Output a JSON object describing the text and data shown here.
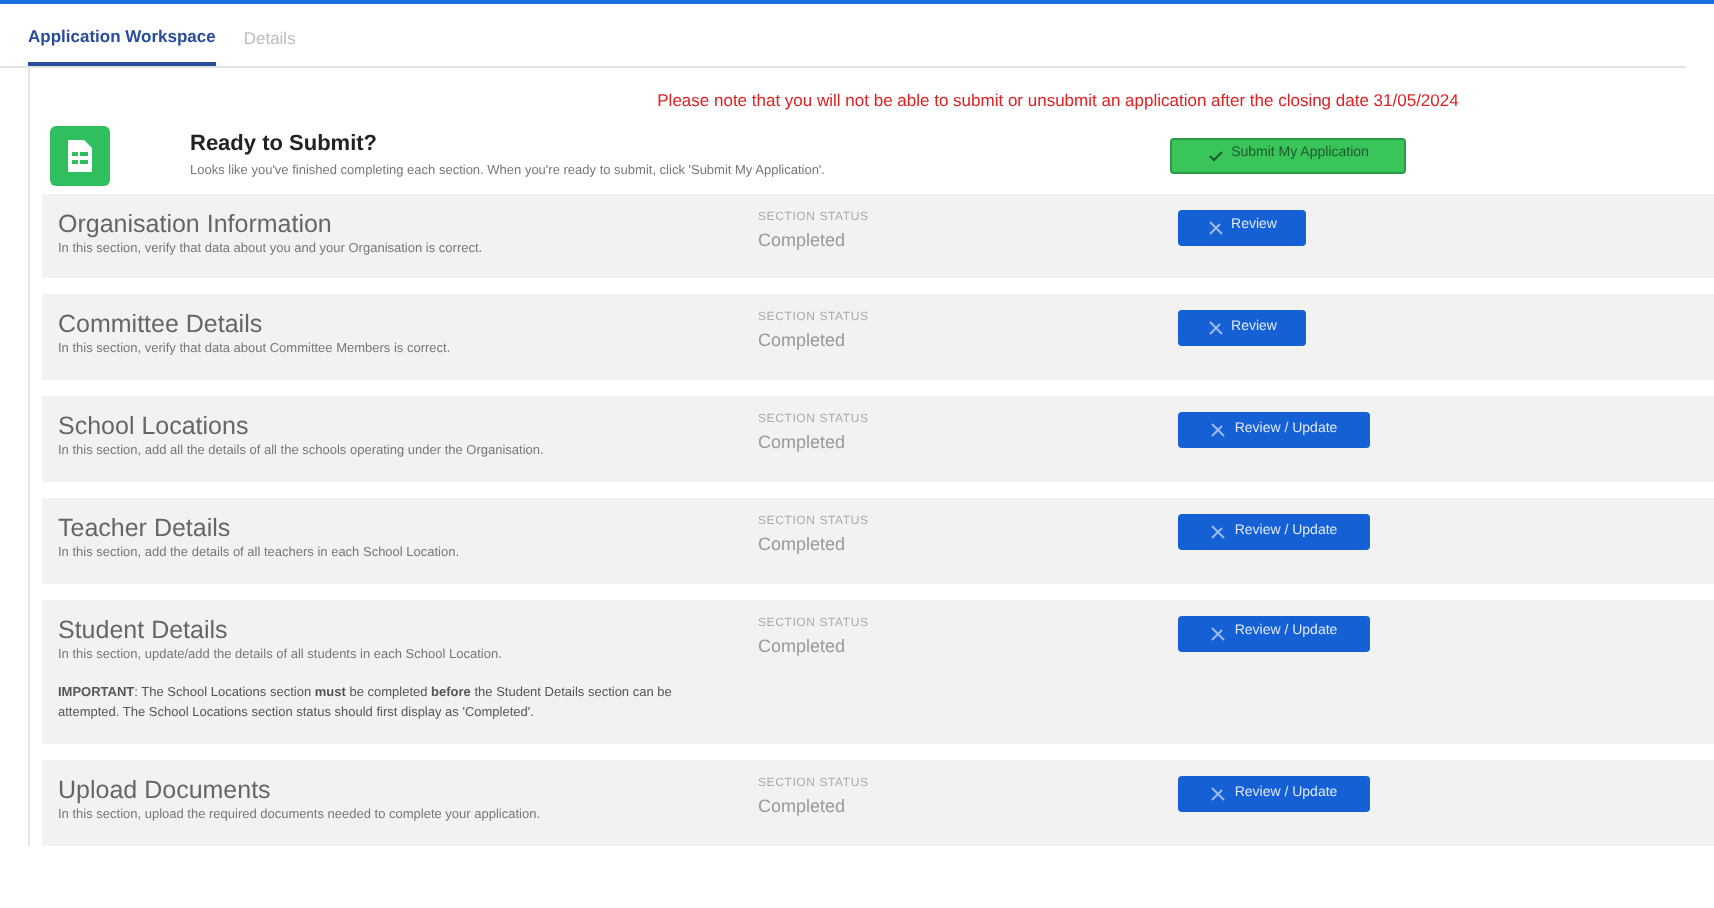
{
  "tabs": [
    {
      "label": "Application Workspace",
      "selected": true
    },
    {
      "label": "Details",
      "selected": false
    }
  ],
  "notice": "Please note that you will not be able to submit or unsubmit an application after the closing date 31/05/2024",
  "ready": {
    "title": "Ready to Submit?",
    "description": "Looks like you've finished completing each section. When you're ready to submit, click 'Submit My Application'.",
    "button": "Submit My Application"
  },
  "sections": [
    {
      "title": "Organisation Information",
      "description": "In this section, verify that data about you and your Organisation is correct.",
      "status_label": "SECTION STATUS",
      "status": "Completed",
      "button": "Review"
    },
    {
      "title": "Committee Details",
      "description": "In this section, verify that data about Committee Members is correct.",
      "status_label": "SECTION STATUS",
      "status": "Completed",
      "button": "Review"
    },
    {
      "title": "School Locations",
      "description": "In this section, add all the details of all the schools operating under the Organisation.",
      "status_label": "SECTION STATUS",
      "status": "Completed",
      "button": "Review / Update"
    },
    {
      "title": "Teacher Details",
      "description": "In this section, add the details of all teachers in each School Location.",
      "status_label": "SECTION STATUS",
      "status": "Completed",
      "button": "Review / Update"
    },
    {
      "title": "Student Details",
      "description": "In this section, update/add the details of all students in each School Location.",
      "note": "**IMPORTANT**: The School Locations section **must** be completed **before** the Student Details section can be attempted. The School Locations section status should first display as 'Completed'.",
      "status_label": "SECTION STATUS",
      "status": "Completed",
      "button": "Review / Update"
    },
    {
      "title": "Upload Documents",
      "description": "In this section, upload the required documents needed to complete your application.",
      "status_label": "SECTION STATUS",
      "status": "Completed",
      "button": "Review / Update"
    }
  ]
}
